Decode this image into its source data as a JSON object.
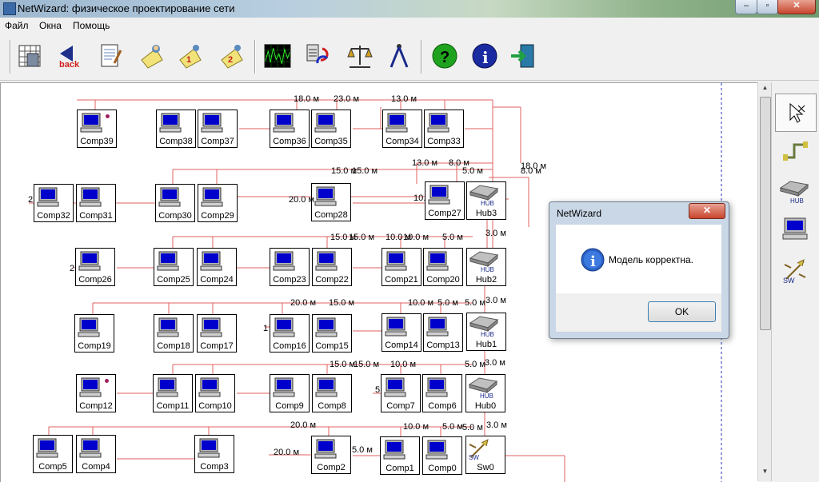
{
  "window": {
    "title": "NetWizard: физическое проектирование сети",
    "min": "–",
    "max": "▫",
    "close": "✕"
  },
  "menu": [
    "Файл",
    "Окна",
    "Помощь"
  ],
  "toolbar_icons": [
    "calculator-grid-icon",
    "back-icon",
    "report-icon",
    "task-icon",
    "task-1-icon",
    "task-2-icon",
    "oscilloscope-icon",
    "recalculate-icon",
    "scales-icon",
    "compass-icon",
    "help-icon",
    "info-icon",
    "exit-icon"
  ],
  "back_text": "back",
  "nodes": [
    {
      "id": "Comp39",
      "label": "Comp39",
      "kind": "pc",
      "dot": true
    },
    {
      "id": "Comp38",
      "label": "Comp38",
      "kind": "pc"
    },
    {
      "id": "Comp37",
      "label": "Comp37",
      "kind": "pc"
    },
    {
      "id": "Comp36",
      "label": "Comp36",
      "kind": "pc"
    },
    {
      "id": "Comp35",
      "label": "Comp35",
      "kind": "pc"
    },
    {
      "id": "Comp34",
      "label": "Comp34",
      "kind": "pc"
    },
    {
      "id": "Comp33",
      "label": "Comp33",
      "kind": "pc"
    },
    {
      "id": "Comp32",
      "label": "Comp32",
      "kind": "pc"
    },
    {
      "id": "Comp31",
      "label": "Comp31",
      "kind": "pc"
    },
    {
      "id": "Comp30",
      "label": "Comp30",
      "kind": "pc"
    },
    {
      "id": "Comp29",
      "label": "Comp29",
      "kind": "pc"
    },
    {
      "id": "Comp28",
      "label": "Comp28",
      "kind": "pc"
    },
    {
      "id": "Comp27",
      "label": "Comp27",
      "kind": "pc"
    },
    {
      "id": "Hub3",
      "label": "Hub3",
      "kind": "hub"
    },
    {
      "id": "Comp26",
      "label": "Comp26",
      "kind": "pc"
    },
    {
      "id": "Comp25",
      "label": "Comp25",
      "kind": "pc"
    },
    {
      "id": "Comp24",
      "label": "Comp24",
      "kind": "pc"
    },
    {
      "id": "Comp23",
      "label": "Comp23",
      "kind": "pc"
    },
    {
      "id": "Comp22",
      "label": "Comp22",
      "kind": "pc"
    },
    {
      "id": "Comp21",
      "label": "Comp21",
      "kind": "pc"
    },
    {
      "id": "Comp20",
      "label": "Comp20",
      "kind": "pc"
    },
    {
      "id": "Hub2",
      "label": "Hub2",
      "kind": "hub"
    },
    {
      "id": "Comp19",
      "label": "Comp19",
      "kind": "pc"
    },
    {
      "id": "Comp18",
      "label": "Comp18",
      "kind": "pc"
    },
    {
      "id": "Comp17",
      "label": "Comp17",
      "kind": "pc"
    },
    {
      "id": "Comp16",
      "label": "Comp16",
      "kind": "pc"
    },
    {
      "id": "Comp15",
      "label": "Comp15",
      "kind": "pc"
    },
    {
      "id": "Comp14",
      "label": "Comp14",
      "kind": "pc"
    },
    {
      "id": "Comp13",
      "label": "Comp13",
      "kind": "pc"
    },
    {
      "id": "Hub1",
      "label": "Hub1",
      "kind": "hub"
    },
    {
      "id": "Comp12",
      "label": "Comp12",
      "kind": "pc",
      "dot": true
    },
    {
      "id": "Comp11",
      "label": "Comp11",
      "kind": "pc"
    },
    {
      "id": "Comp10",
      "label": "Comp10",
      "kind": "pc"
    },
    {
      "id": "Comp9",
      "label": "Comp9",
      "kind": "pc"
    },
    {
      "id": "Comp8",
      "label": "Comp8",
      "kind": "pc"
    },
    {
      "id": "Comp7",
      "label": "Comp7",
      "kind": "pc"
    },
    {
      "id": "Comp6",
      "label": "Comp6",
      "kind": "pc"
    },
    {
      "id": "Hub0",
      "label": "Hub0",
      "kind": "hub"
    },
    {
      "id": "Comp5",
      "label": "Comp5",
      "kind": "pc"
    },
    {
      "id": "Comp4",
      "label": "Comp4",
      "kind": "pc"
    },
    {
      "id": "Comp3",
      "label": "Comp3",
      "kind": "pc"
    },
    {
      "id": "Comp2",
      "label": "Comp2",
      "kind": "pc"
    },
    {
      "id": "Comp1",
      "label": "Comp1",
      "kind": "pc"
    },
    {
      "id": "Comp0",
      "label": "Comp0",
      "kind": "pc"
    },
    {
      "id": "Sw0",
      "label": "Sw0",
      "kind": "switch"
    }
  ],
  "wire_labels": [
    "18.0 м",
    "23.0 м",
    "13.0 м",
    "13.0 м",
    "8.0 м",
    "5.0 м",
    "18.0 м",
    "8.0 м",
    "15.0 м",
    "15.0 м",
    "20.0 м",
    "10.",
    "2",
    "3.0 м",
    "15.0 м",
    "15.0 м",
    "10.0 м",
    "10.0 м",
    "5.0 м",
    "2",
    "20.0 м",
    "15.0 м",
    "10.0 м",
    "5.0 м",
    "5.0 м",
    "3.0 м",
    "1",
    "15.0 м",
    "15.0 м",
    "10.0 м",
    "5.0 м",
    "3.0 м",
    "5",
    "20.0 м",
    "10.0 м",
    "5.0 м",
    "5.0 м",
    "3.0 м",
    "20.0 м",
    "5.0 м"
  ],
  "palette": [
    {
      "name": "pointer-tool-icon",
      "selected": true
    },
    {
      "name": "cable-tool-icon"
    },
    {
      "name": "hub-tool-icon",
      "text": "HUB"
    },
    {
      "name": "computer-tool-icon"
    },
    {
      "name": "switch-tool-icon",
      "text": "SW"
    }
  ],
  "hub_text": "HUB",
  "switch_text": "SW",
  "dialog": {
    "title": "NetWizard",
    "message": "Модель корректна.",
    "ok": "OK",
    "close": "✕"
  },
  "colors": {
    "wire": "#e06060",
    "screen": "#0000cc",
    "dot": "#a0205f"
  }
}
